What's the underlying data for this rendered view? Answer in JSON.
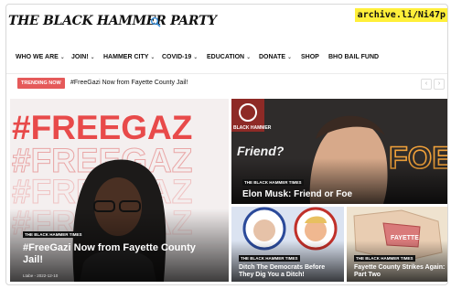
{
  "header": {
    "logo_text": "THE BLACK HAMMER PARTY",
    "search_icon": "search-icon",
    "archive_link": "archive.li/Ni47p"
  },
  "nav": {
    "items": [
      {
        "label": "WHO WE ARE",
        "dropdown": true
      },
      {
        "label": "JOIN!",
        "dropdown": true
      },
      {
        "label": "HAMMER CITY",
        "dropdown": true
      },
      {
        "label": "COVID-19",
        "dropdown": true
      },
      {
        "label": "EDUCATION",
        "dropdown": true
      },
      {
        "label": "DONATE",
        "dropdown": true
      },
      {
        "label": "SHOP",
        "dropdown": false
      },
      {
        "label": "BHO BAIL FUND",
        "dropdown": false
      }
    ]
  },
  "trending": {
    "badge": "TRENDING NOW",
    "headline": "#FreeGazi Now from Fayette County Jail!",
    "prev_icon": "chevron-left-icon",
    "next_icon": "chevron-right-icon"
  },
  "banner_text": "#FREEGAZ",
  "logo_badge_text": "BLACK HAMMER",
  "friend_text": "Friend?",
  "foe_text": "FOE?",
  "main_card": {
    "tag": "THE BLACK HAMMER TIMES",
    "title": "#FreeGazi Now from Fayette County Jail!",
    "author": "Ltabe",
    "date": "2022-12-10"
  },
  "card_elon": {
    "tag": "THE BLACK HAMMER TIMES",
    "title": "Elon Musk: Friend or Foe"
  },
  "card_democrats": {
    "tag": "THE BLACK HAMMER TIMES",
    "title": "Ditch The Democrats Before They Dig You a Ditch!"
  },
  "card_fayette": {
    "tag": "THE BLACK HAMMER TIMES",
    "title": "Fayette County Strikes Again: Part Two",
    "map_label": "FAYETTE"
  },
  "colors": {
    "trending_badge": "#e55a5a",
    "archive_highlight": "#ffef3a",
    "banner_red": "#e84a4a",
    "foe_orange": "#f2a23a"
  }
}
